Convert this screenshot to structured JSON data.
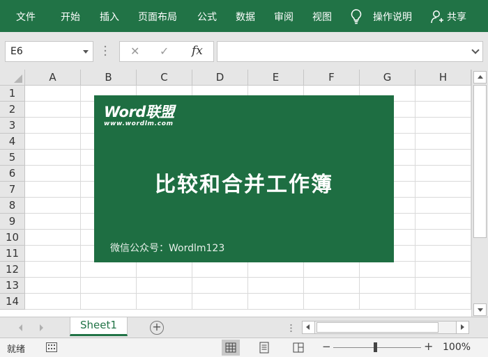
{
  "ribbon": {
    "tabs": [
      "文件",
      "开始",
      "插入",
      "页面布局",
      "公式",
      "数据",
      "审阅",
      "视图"
    ],
    "help_label": "操作说明",
    "share_label": "共享"
  },
  "formula_bar": {
    "name_box": "E6",
    "fx_label": "fx",
    "formula_value": ""
  },
  "grid": {
    "columns": [
      "A",
      "B",
      "C",
      "D",
      "E",
      "F",
      "G",
      "H"
    ],
    "rows": [
      "1",
      "2",
      "3",
      "4",
      "5",
      "6",
      "7",
      "8",
      "9",
      "10",
      "11",
      "12",
      "13",
      "14"
    ]
  },
  "banner": {
    "logo_word": "Word联盟",
    "logo_url": "www.wordlm.com",
    "title": "比较和合并工作簿",
    "footer": "微信公众号：Wordlm123",
    "background_color": "#1e6e42"
  },
  "sheets": {
    "active": "Sheet1",
    "add_icon": "plus-circle-icon"
  },
  "status": {
    "text": "就绪",
    "zoom": "100%",
    "zoom_minus": "−",
    "zoom_plus": "+"
  },
  "colors": {
    "accent": "#217346",
    "ribbon": "#217346"
  }
}
